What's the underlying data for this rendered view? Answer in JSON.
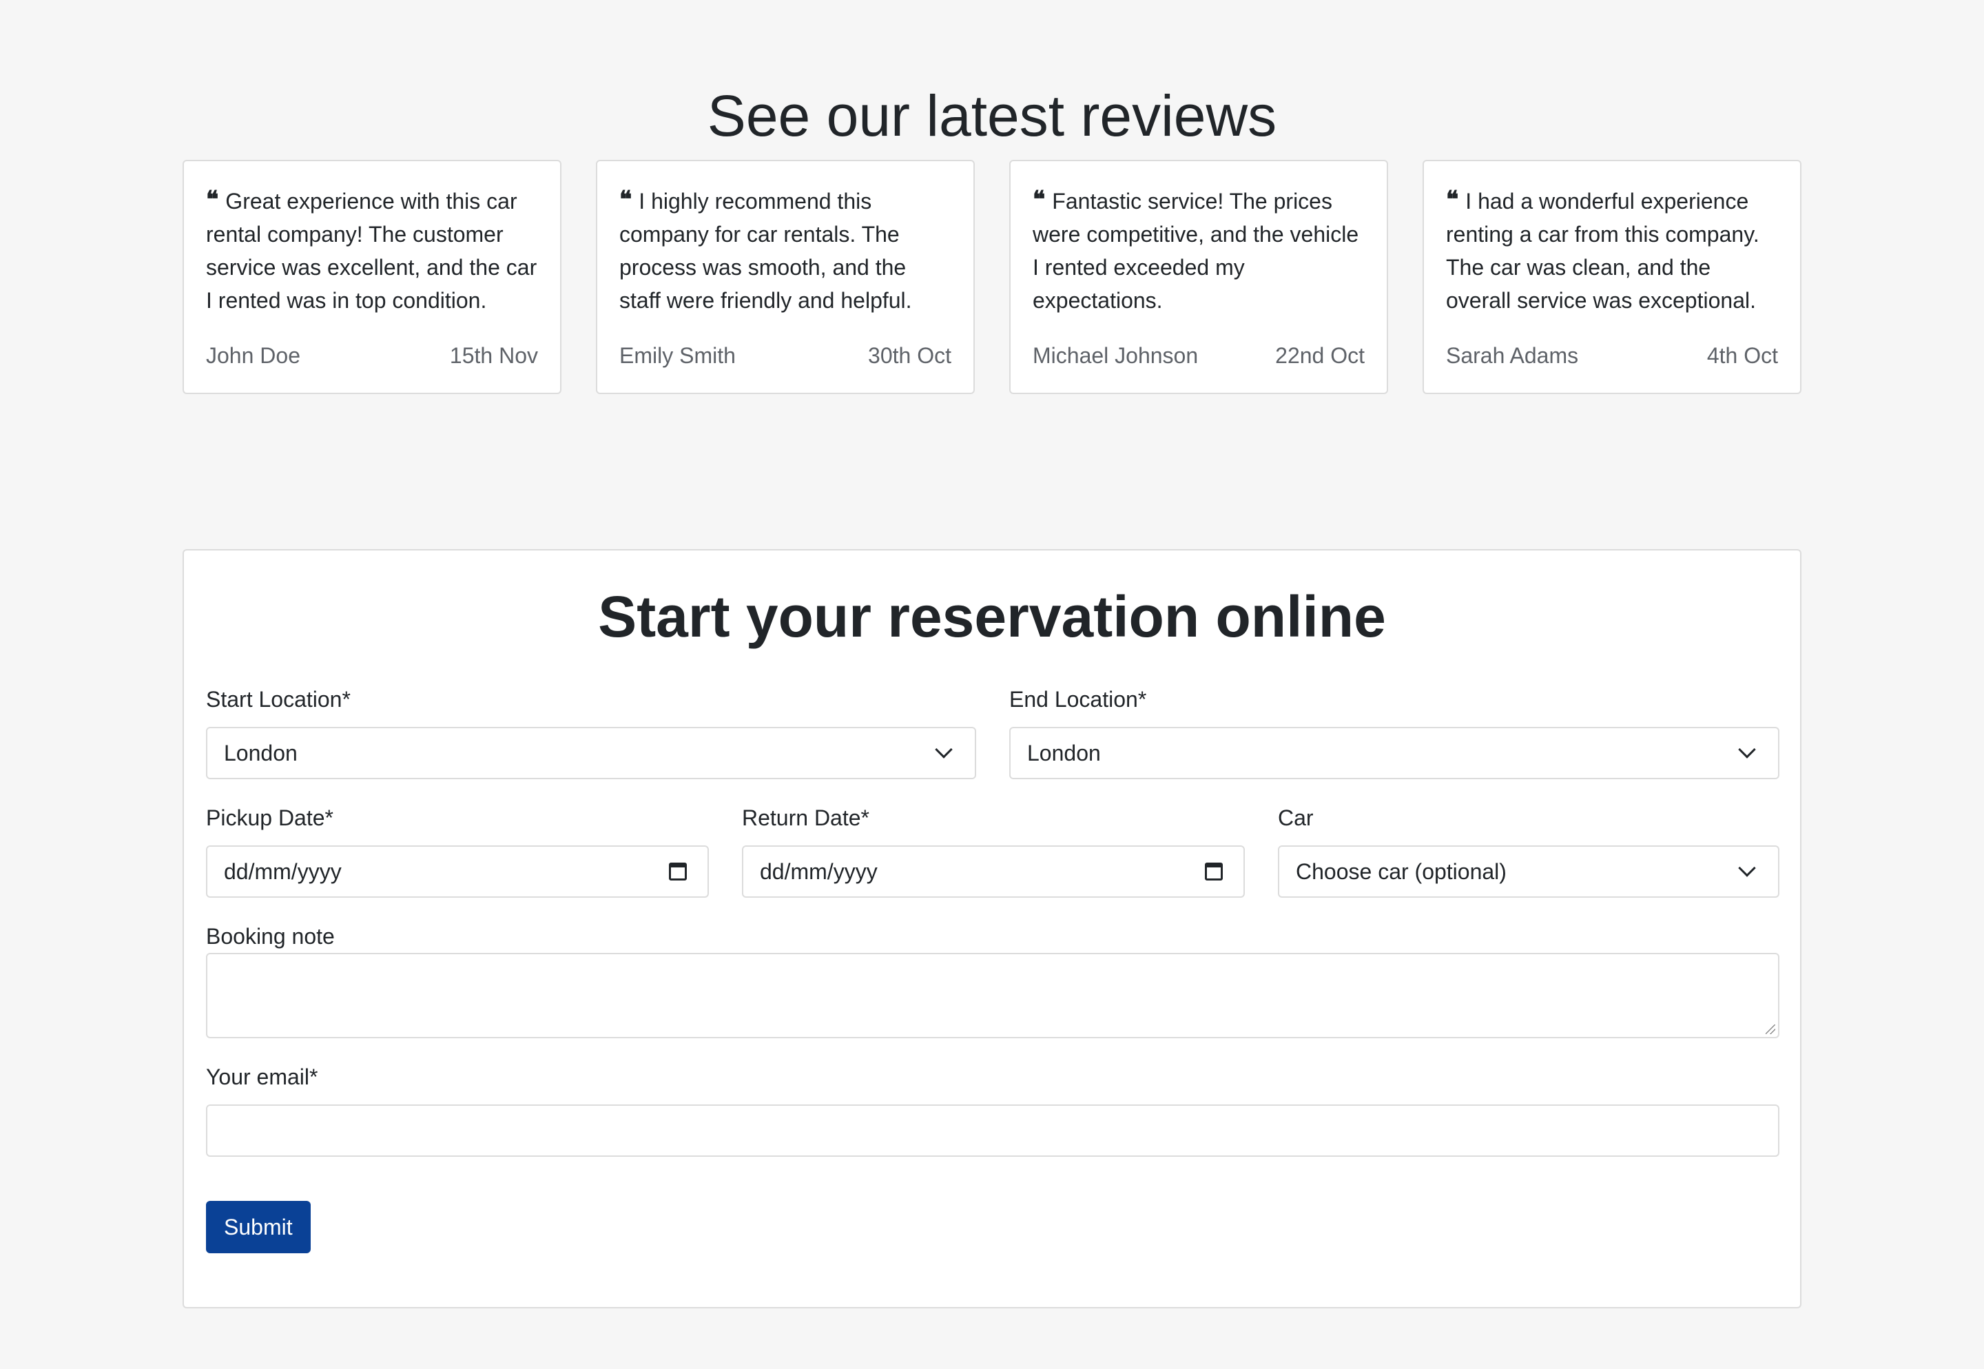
{
  "reviews": {
    "title": "See our latest reviews",
    "items": [
      {
        "text": "Great experience with this car rental company! The customer service was excellent, and the car I rented was in top condition.",
        "author": "John Doe",
        "date": "15th Nov"
      },
      {
        "text": "I highly recommend this company for car rentals. The process was smooth, and the staff were friendly and helpful.",
        "author": "Emily Smith",
        "date": "30th Oct"
      },
      {
        "text": "Fantastic service! The prices were competitive, and the vehicle I rented exceeded my expectations.",
        "author": "Michael Johnson",
        "date": "22nd Oct"
      },
      {
        "text": "I had a wonderful experience renting a car from this company. The car was clean, and the overall service was exceptional.",
        "author": "Sarah Adams",
        "date": "4th Oct"
      }
    ],
    "quote_glyph": "❝"
  },
  "form": {
    "title": "Start your reservation online",
    "start_location": {
      "label": "Start Location*",
      "value": "London"
    },
    "end_location": {
      "label": "End Location*",
      "value": "London"
    },
    "pickup_date": {
      "label": "Pickup Date*",
      "placeholder": "dd/mm/yyyy"
    },
    "return_date": {
      "label": "Return Date*",
      "placeholder": "dd/mm/yyyy"
    },
    "car": {
      "label": "Car",
      "value": "Choose car (optional)"
    },
    "booking_note": {
      "label": "Booking note",
      "value": ""
    },
    "email": {
      "label": "Your email*",
      "value": ""
    },
    "submit_label": "Submit"
  },
  "colors": {
    "background": "#f6f6f6",
    "card": "#ffffff",
    "border": "#dcdcdc",
    "primary_button": "#0a4196",
    "text": "#212529",
    "muted_text": "#5e6268"
  },
  "icons": {
    "quote": "quote-icon",
    "select": "chevron-down-icon",
    "date": "calendar-icon"
  }
}
